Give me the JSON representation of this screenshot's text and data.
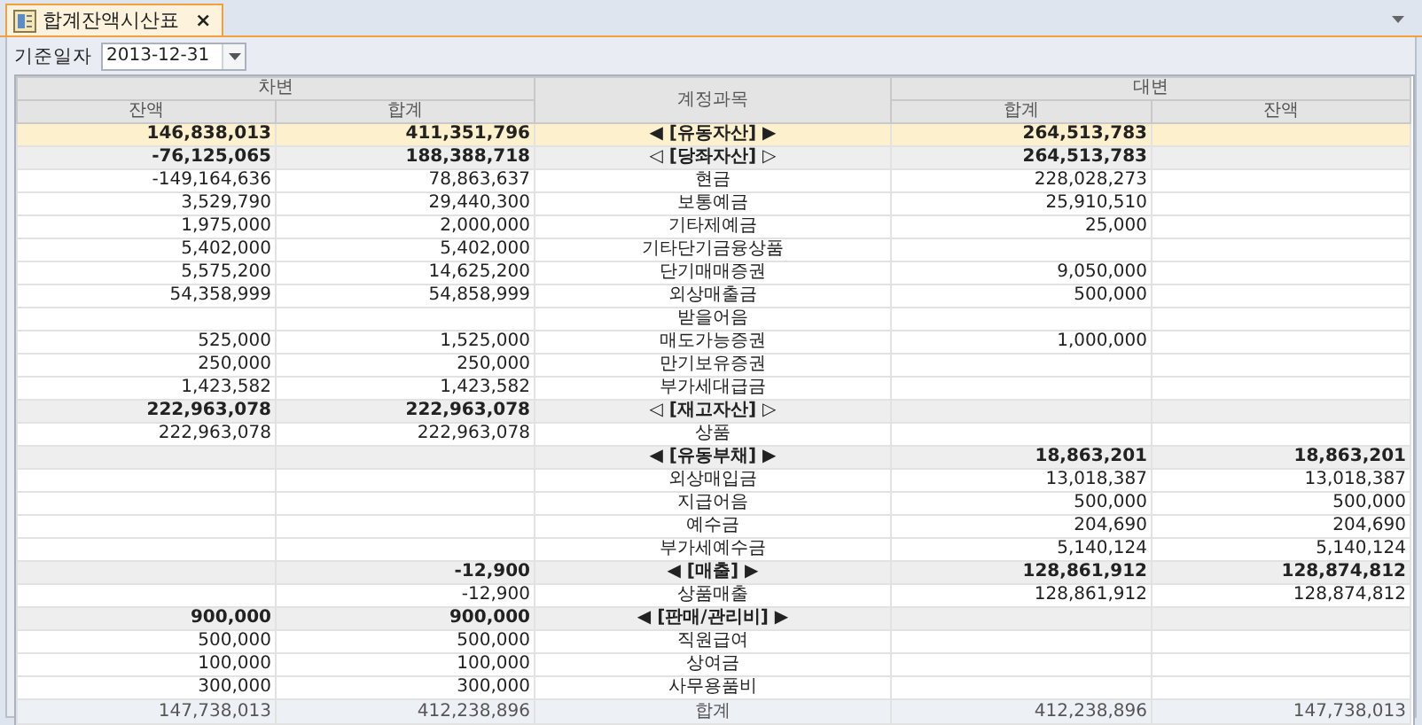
{
  "tab": {
    "title": "합계잔액시산표",
    "close": "×",
    "selected": true
  },
  "filter": {
    "label": "기준일자",
    "date": "2013-12-31"
  },
  "table": {
    "header": {
      "debit": "차변",
      "account": "계정과목",
      "credit": "대변",
      "debit_columns": [
        "잔액",
        "합계"
      ],
      "credit_columns": [
        "합계",
        "잔액"
      ]
    },
    "rows": [
      {
        "kind": "group",
        "selected": true,
        "cells": [
          "146,838,013",
          "411,351,796",
          "◀ [유동자산] ▶",
          "264,513,783",
          ""
        ]
      },
      {
        "kind": "subgroup",
        "selected": false,
        "cells": [
          "-76,125,065",
          "188,388,718",
          "◁ [당좌자산] ▷",
          "264,513,783",
          ""
        ]
      },
      {
        "kind": "item",
        "selected": false,
        "cells": [
          "-149,164,636",
          "78,863,637",
          "현금",
          "228,028,273",
          ""
        ]
      },
      {
        "kind": "item",
        "selected": false,
        "cells": [
          "3,529,790",
          "29,440,300",
          "보통예금",
          "25,910,510",
          ""
        ]
      },
      {
        "kind": "item",
        "selected": false,
        "cells": [
          "1,975,000",
          "2,000,000",
          "기타제예금",
          "25,000",
          ""
        ]
      },
      {
        "kind": "item",
        "selected": false,
        "cells": [
          "5,402,000",
          "5,402,000",
          "기타단기금융상품",
          "",
          ""
        ]
      },
      {
        "kind": "item",
        "selected": false,
        "cells": [
          "5,575,200",
          "14,625,200",
          "단기매매증권",
          "9,050,000",
          ""
        ]
      },
      {
        "kind": "item",
        "selected": false,
        "cells": [
          "54,358,999",
          "54,858,999",
          "외상매출금",
          "500,000",
          ""
        ]
      },
      {
        "kind": "item",
        "selected": false,
        "cells": [
          "",
          "",
          "받을어음",
          "",
          ""
        ]
      },
      {
        "kind": "item",
        "selected": false,
        "cells": [
          "525,000",
          "1,525,000",
          "매도가능증권",
          "1,000,000",
          ""
        ]
      },
      {
        "kind": "item",
        "selected": false,
        "cells": [
          "250,000",
          "250,000",
          "만기보유증권",
          "",
          ""
        ]
      },
      {
        "kind": "item",
        "selected": false,
        "cells": [
          "1,423,582",
          "1,423,582",
          "부가세대급금",
          "",
          ""
        ]
      },
      {
        "kind": "subgroup",
        "selected": false,
        "cells": [
          "222,963,078",
          "222,963,078",
          "◁ [재고자산] ▷",
          "",
          ""
        ]
      },
      {
        "kind": "item",
        "selected": false,
        "cells": [
          "222,963,078",
          "222,963,078",
          "상품",
          "",
          ""
        ]
      },
      {
        "kind": "group",
        "selected": false,
        "cells": [
          "",
          "",
          "◀ [유동부채] ▶",
          "18,863,201",
          "18,863,201"
        ]
      },
      {
        "kind": "item",
        "selected": false,
        "cells": [
          "",
          "",
          "외상매입금",
          "13,018,387",
          "13,018,387"
        ]
      },
      {
        "kind": "item",
        "selected": false,
        "cells": [
          "",
          "",
          "지급어음",
          "500,000",
          "500,000"
        ]
      },
      {
        "kind": "item",
        "selected": false,
        "cells": [
          "",
          "",
          "예수금",
          "204,690",
          "204,690"
        ]
      },
      {
        "kind": "item",
        "selected": false,
        "cells": [
          "",
          "",
          "부가세예수금",
          "5,140,124",
          "5,140,124"
        ]
      },
      {
        "kind": "group",
        "selected": false,
        "cells": [
          "",
          "-12,900",
          "◀ [매출] ▶",
          "128,861,912",
          "128,874,812"
        ]
      },
      {
        "kind": "item",
        "selected": false,
        "cells": [
          "",
          "-12,900",
          "상품매출",
          "128,861,912",
          "128,874,812"
        ]
      },
      {
        "kind": "group",
        "selected": false,
        "cells": [
          "900,000",
          "900,000",
          "◀ [판매/관리비] ▶",
          "",
          ""
        ]
      },
      {
        "kind": "item",
        "selected": false,
        "cells": [
          "500,000",
          "500,000",
          "직원급여",
          "",
          ""
        ]
      },
      {
        "kind": "item",
        "selected": false,
        "cells": [
          "100,000",
          "100,000",
          "상여금",
          "",
          ""
        ]
      },
      {
        "kind": "item",
        "selected": false,
        "cells": [
          "300,000",
          "300,000",
          "사무용품비",
          "",
          ""
        ]
      }
    ],
    "footer": [
      "147,738,013",
      "412,238,896",
      "합계",
      "412,238,896",
      "147,738,013"
    ]
  }
}
